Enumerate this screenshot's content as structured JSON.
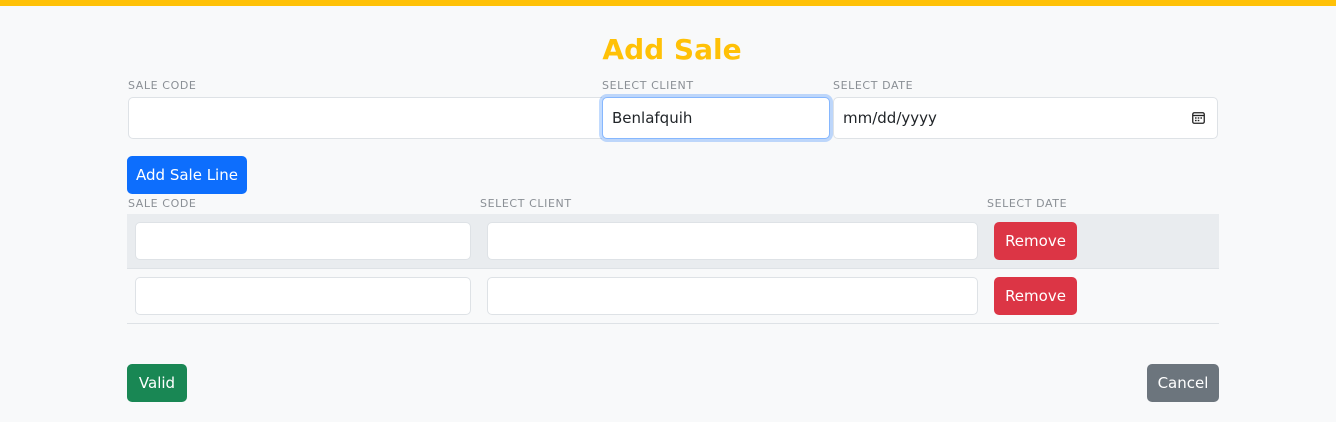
{
  "page": {
    "title": "Add Sale"
  },
  "header_form": {
    "sale_code_label": "SALE CODE",
    "sale_code_value": "",
    "client_label": "SELECT CLIENT",
    "client_value": "Benlafquih",
    "date_label": "SELECT DATE",
    "date_placeholder": "mm/dd/yyyy"
  },
  "add_line_button": "Add Sale Line",
  "lines_table": {
    "headers": [
      "SALE CODE",
      "SELECT CLIENT",
      "SELECT DATE"
    ],
    "rows": [
      {
        "code": "",
        "client": "",
        "remove_label": "Remove"
      },
      {
        "code": "",
        "client": "",
        "remove_label": "Remove"
      }
    ]
  },
  "footer": {
    "valid_label": "Valid",
    "cancel_label": "Cancel"
  },
  "colors": {
    "accent": "#ffc107",
    "primary": "#0d6efd",
    "danger": "#dc3545",
    "success": "#198754",
    "secondary": "#6c757d"
  },
  "icons": {
    "date_picker": "calendar-icon"
  }
}
